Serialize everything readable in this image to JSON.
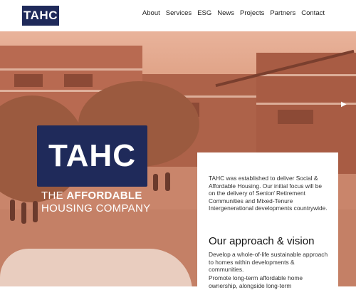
{
  "brand": {
    "logo_text": "TAHC"
  },
  "nav": {
    "items": [
      "About",
      "Services",
      "ESG",
      "News",
      "Projects",
      "Partners",
      "Contact"
    ]
  },
  "hero": {
    "logo_text": "TAHC",
    "tagline_line1_prefix": "THE ",
    "tagline_line1_bold": "AFFORDABLE",
    "tagline_line2": "HOUSING COMPANY"
  },
  "card": {
    "intro": "TAHC was established to deliver Social & Affordable Housing. Our initial focus will be on the delivery of Senior/ Retirement Communities and Mixed-Tenure Intergenerational developments countrywide.",
    "heading": "Our approach & vision",
    "para1": "Develop a whole-of-life sustainable approach to homes within developments & communities.",
    "para2": "Promote long-term affordable home ownership, alongside long-term"
  }
}
